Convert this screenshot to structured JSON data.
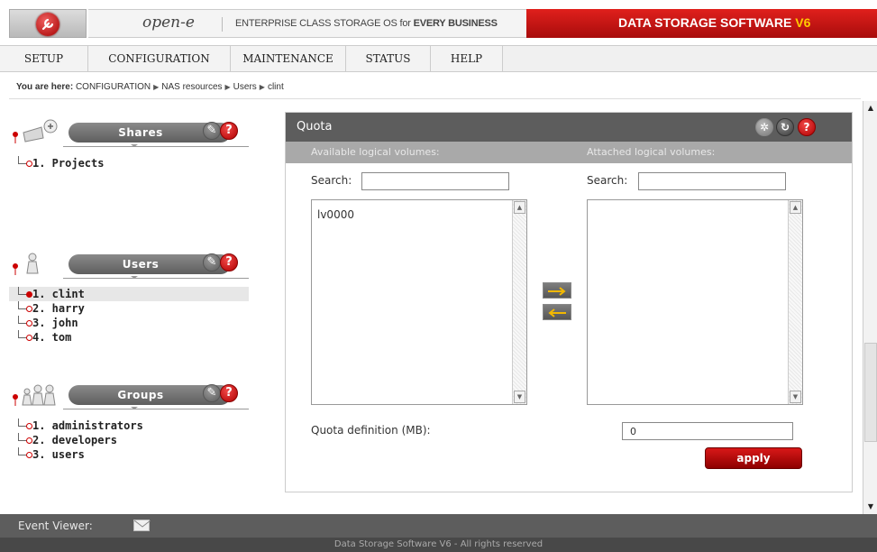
{
  "header": {
    "brand_name": "open-e",
    "tagline_prefix": "ENTERPRISE CLASS STORAGE OS for ",
    "tagline_bold": "EVERY BUSINESS",
    "product_name": "DATA STORAGE SOFTWARE",
    "product_version": "V6",
    "colors": {
      "accent_red": "#c41010",
      "version_yellow": "#ffcc00"
    }
  },
  "menu": {
    "items": [
      {
        "label": "SETUP"
      },
      {
        "label": "CONFIGURATION"
      },
      {
        "label": "MAINTENANCE"
      },
      {
        "label": "STATUS"
      },
      {
        "label": "HELP"
      }
    ]
  },
  "breadcrumb": {
    "label": "You are here:",
    "parts": [
      "CONFIGURATION",
      "NAS resources",
      "Users",
      "clint"
    ]
  },
  "sidebar": {
    "shares": {
      "title": "Shares",
      "items": [
        {
          "label": "1. Projects"
        }
      ]
    },
    "users": {
      "title": "Users",
      "items": [
        {
          "label": "1. clint",
          "selected": true
        },
        {
          "label": "2. harry"
        },
        {
          "label": "3. john"
        },
        {
          "label": "4. tom"
        }
      ]
    },
    "groups": {
      "title": "Groups",
      "items": [
        {
          "label": "1. administrators"
        },
        {
          "label": "2. developers"
        },
        {
          "label": "3. users"
        }
      ]
    }
  },
  "quota": {
    "title": "Quota",
    "available_heading": "Available logical volumes:",
    "attached_heading": "Attached logical volumes:",
    "search_label": "Search:",
    "available_search_value": "",
    "attached_search_value": "",
    "available_volumes": [
      "lv0000"
    ],
    "attached_volumes": [],
    "quota_label": "Quota definition (MB):",
    "quota_value": "0",
    "apply_label": "apply"
  },
  "footer": {
    "event_viewer_label": "Event Viewer:",
    "copyright": "Data Storage Software V6 - All rights reserved"
  }
}
